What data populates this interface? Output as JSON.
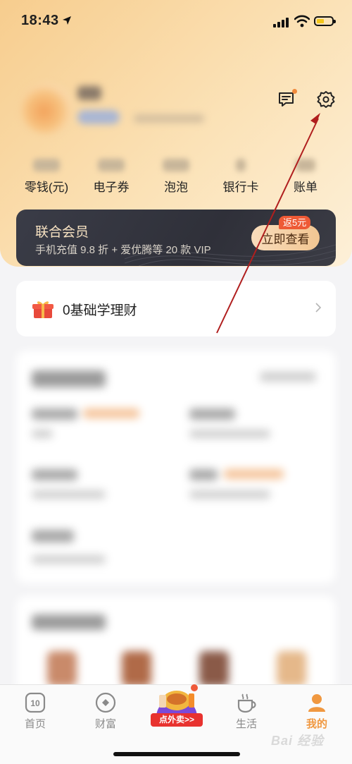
{
  "status_bar": {
    "time": "18:43"
  },
  "header": {
    "message_icon": "message-icon",
    "settings_icon": "gear-icon"
  },
  "assets": [
    {
      "label": "零钱(元)"
    },
    {
      "label": "电子券"
    },
    {
      "label": "泡泡"
    },
    {
      "label": "银行卡"
    },
    {
      "label": "账单"
    }
  ],
  "member_card": {
    "title": "联合会员",
    "subtitle": "手机充值 9.8 折 + 爱优腾等 20 款 VIP",
    "button": "立即查看",
    "tag": "返5元"
  },
  "finance_entry": {
    "label": "0基础学理财"
  },
  "tabs": [
    {
      "label": "首页"
    },
    {
      "label": "财富"
    },
    {
      "label": "点外卖>>"
    },
    {
      "label": "生活"
    },
    {
      "label": "我的"
    }
  ],
  "colors": {
    "accent": "#f09840",
    "card_dark": "#2f3039",
    "tag_red": "#ee5a36"
  }
}
